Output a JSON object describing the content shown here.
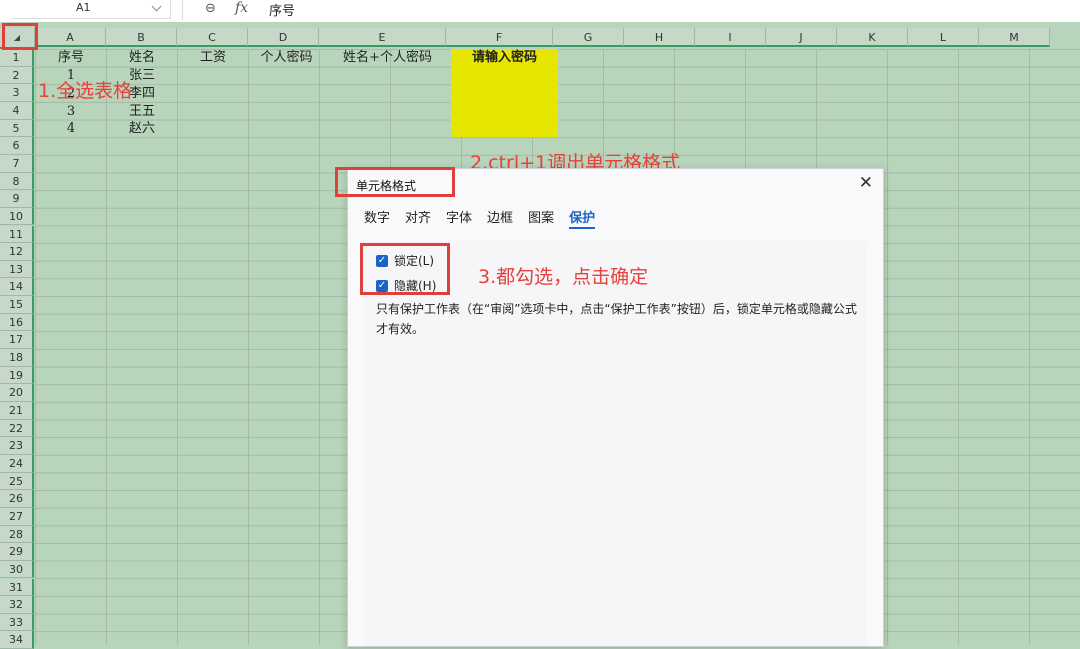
{
  "formula_bar": {
    "cell_ref": "A1",
    "fx": "fx",
    "content": "序号"
  },
  "columns": [
    "A",
    "B",
    "C",
    "D",
    "E",
    "F",
    "G",
    "H",
    "I",
    "J",
    "K",
    "L",
    "M"
  ],
  "rows": [
    "1",
    "2",
    "3",
    "4",
    "5",
    "6",
    "7",
    "8",
    "9",
    "10",
    "11",
    "12",
    "13",
    "14",
    "15",
    "16",
    "17",
    "18",
    "19",
    "20",
    "21",
    "22",
    "23",
    "24",
    "25",
    "26",
    "27",
    "28",
    "29",
    "30",
    "31",
    "32",
    "33",
    "34"
  ],
  "table": {
    "headers": [
      "序号",
      "姓名",
      "工资",
      "个人密码",
      "姓名+个人密码",
      "请输入密码"
    ],
    "serials": [
      "1",
      "2",
      "3",
      "4"
    ],
    "names": [
      "张三",
      "李四",
      "王五",
      "赵六"
    ]
  },
  "annotations": {
    "step1": "1.全选表格",
    "step2": "2.ctrl+1调出单元格格式",
    "step3": "3.都勾选，点击确定"
  },
  "dialog": {
    "title": "单元格格式",
    "tabs": [
      "数字",
      "对齐",
      "字体",
      "边框",
      "图案",
      "保护"
    ],
    "active_tab": "保护",
    "locked_label": "锁定(L)",
    "hidden_label": "隐藏(H)",
    "description": "只有保护工作表（在“审阅”选项卡中，点击“保护工作表”按钮）后，锁定单元格或隐藏公式才有效。"
  },
  "colors": {
    "sheet_bg": "#b8d4bb",
    "highlight": "#e6e600",
    "annotation": "#e8403a",
    "accent": "#1c63c9"
  },
  "icons": {
    "zoom": "zoom-icon",
    "close": "close-icon",
    "select_all": "select-all-triangle-icon",
    "check": "checkmark-icon"
  }
}
